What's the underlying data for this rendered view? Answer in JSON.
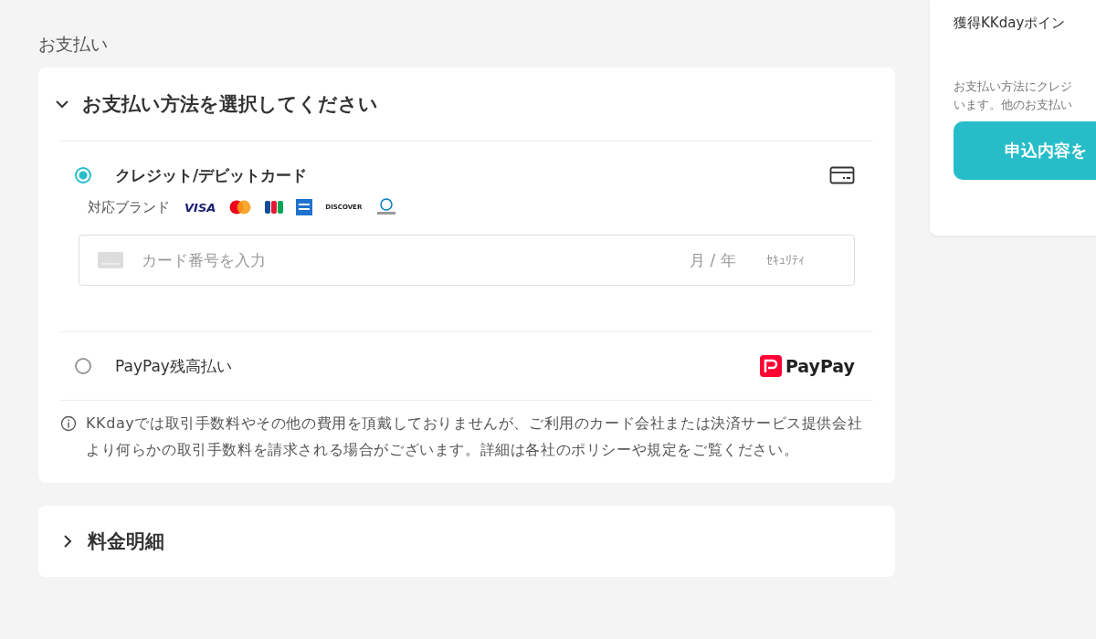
{
  "section_title": "お支払い",
  "payment_card": {
    "title": "お支払い方法を選択してください",
    "expanded": true,
    "methods": [
      {
        "kind": "card",
        "label": "クレジット/デビットカード",
        "selected": true,
        "brands_label": "対応ブランド",
        "brands": [
          {
            "kind": "visa",
            "text": "VISA"
          },
          {
            "kind": "mastercard"
          },
          {
            "kind": "jcb"
          },
          {
            "kind": "amex"
          },
          {
            "kind": "discover",
            "text": "DISCOVER"
          },
          {
            "kind": "diners"
          }
        ],
        "card_field": {
          "number_placeholder": "カード番号を入力",
          "expiry_placeholder": "月 / 年",
          "security_placeholder": "ｾｷｭﾘﾃｨ"
        }
      },
      {
        "kind": "paypay",
        "label": "PayPay残高払い",
        "selected": false,
        "logo_text": "PayPay"
      }
    ],
    "notice": "KKdayでは取引手数料やその他の費用を頂戴しておりませんが、ご利用のカード会社または決済サービス提供会社より何らかの取引手数料を請求される場合がございます。詳細は各社のポリシーや規定をご覧ください。"
  },
  "fee_section": {
    "title": "料金明細",
    "expanded": false
  },
  "summary_panel": {
    "points_label": "獲得KKdayポイン",
    "note_lines": [
      "お支払い方法にクレジ",
      "います。他のお支払い"
    ],
    "submit_button": "申込内容を"
  }
}
